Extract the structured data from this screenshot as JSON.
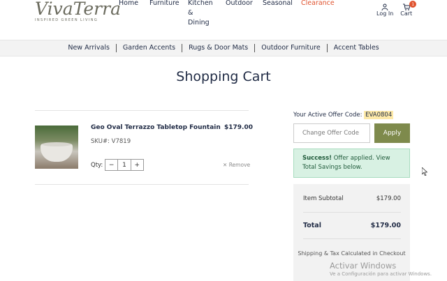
{
  "logo": {
    "name": "VivaTerra",
    "tagline": "INSPIRED GREEN LIVING"
  },
  "topnav": [
    {
      "label": "Home"
    },
    {
      "label": "Furniture"
    },
    {
      "label": "Kitchen\n&\nDining"
    },
    {
      "label": "Outdoor"
    },
    {
      "label": "Seasonal"
    },
    {
      "label": "Clearance"
    }
  ],
  "account": {
    "login_label": "Log In",
    "cart_label": "Cart",
    "cart_count": "1"
  },
  "categories": [
    "New Arrivals",
    "Garden Accents",
    "Rugs & Door Mats",
    "Outdoor Furniture",
    "Accent Tables"
  ],
  "page_title": "Shopping Cart",
  "cart_item": {
    "name": "Geo Oval Terrazzo Tabletop Fountain",
    "sku": "SKU#: V7819",
    "price": "$179.00",
    "qty_label": "Qty:",
    "qty_minus": "−",
    "quantity": "1",
    "qty_plus": "+",
    "remove_label": "Remove"
  },
  "offer": {
    "label": "Your Active Offer Code:",
    "code": "EVA0804",
    "input_placeholder": "Change Offer Code",
    "apply_label": "Apply",
    "success_bold": "Success!",
    "success_text": " Offer applied. View Total Savings below."
  },
  "summary": {
    "subtotal_label": "Item Subtotal",
    "subtotal_value": "$179.00",
    "total_label": "Total",
    "total_value": "$179.00",
    "shipping_note": "Shipping & Tax Calculated in Checkout"
  },
  "watermark": {
    "line1": "Activar Windows",
    "line2": "Ve a Configuración para activar Windows."
  },
  "colors": {
    "accent": "#e0532f",
    "apply_button": "#7e8a4c",
    "success_bg": "#d8f1e3",
    "text": "#1f2a44"
  }
}
